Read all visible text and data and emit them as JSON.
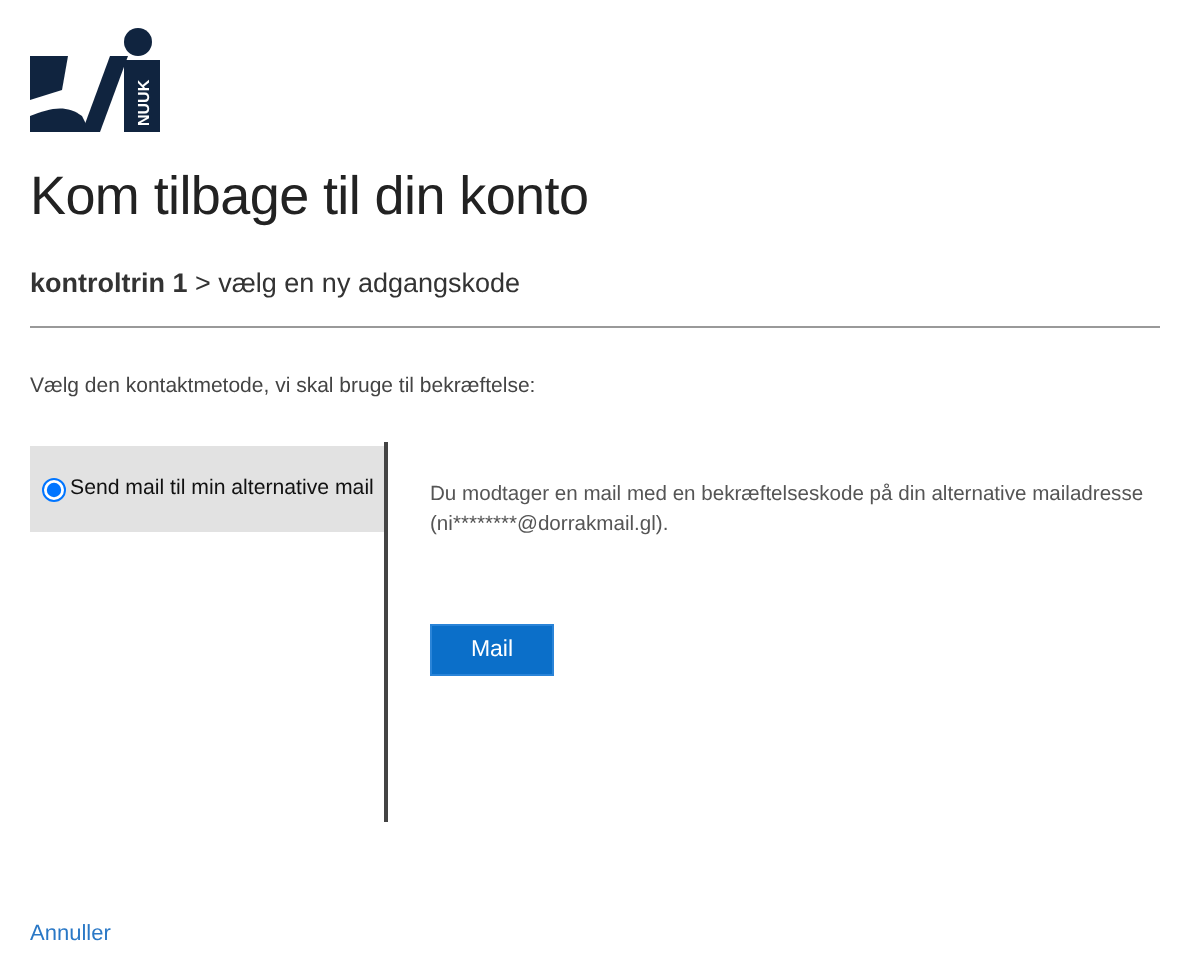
{
  "logo": {
    "text": "NUUK"
  },
  "title": "Kom tilbage til din konto",
  "breadcrumb": {
    "current": "kontroltrin 1",
    "separator": ">",
    "next": "vælg en ny adgangskode"
  },
  "instruction": "Vælg den kontaktmetode, vi skal bruge til bekræftelse:",
  "methods": [
    {
      "label": "Send mail til min alternative mail",
      "selected": true
    }
  ],
  "detail": {
    "text": "Du modtager en mail med en bekræftelseskode på din alternative mailadresse (ni********@dorrakmail.gl).",
    "button": "Mail"
  },
  "cancel": "Annuller"
}
